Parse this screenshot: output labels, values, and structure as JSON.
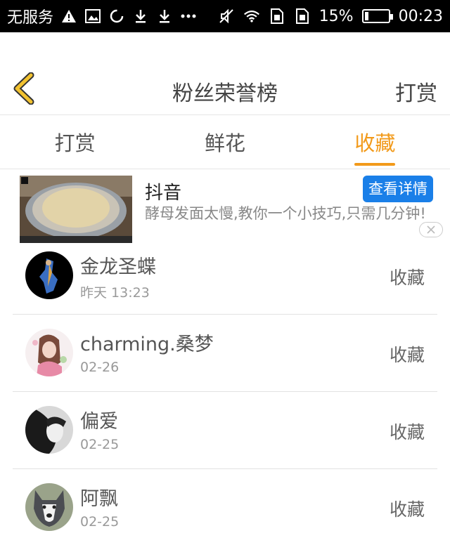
{
  "status_bar": {
    "carrier": "无服务",
    "battery_percent_text": "15%",
    "battery_level": 0.15,
    "time": "00:23"
  },
  "header": {
    "title": "粉丝荣誉榜",
    "action_label": "打赏"
  },
  "tabs": [
    {
      "label": "打赏",
      "active": false
    },
    {
      "label": "鲜花",
      "active": false
    },
    {
      "label": "收藏",
      "active": true
    }
  ],
  "ad": {
    "title": "抖音",
    "description": "酵母发面太慢,教你一个小技巧,只需几分钟!",
    "detail_button": "查看详情"
  },
  "fans": [
    {
      "name": "金龙圣蝶",
      "time": "昨天 13:23",
      "action": "收藏"
    },
    {
      "name": "charming.桑梦",
      "time": "02-26",
      "action": "收藏"
    },
    {
      "name": "偏爱",
      "time": "02-25",
      "action": "收藏"
    },
    {
      "name": "阿飘",
      "time": "02-25",
      "action": "收藏"
    }
  ],
  "colors": {
    "accent": "#f29a1a",
    "ad_button": "#1a7fe8",
    "back_icon": "#f2c230"
  }
}
